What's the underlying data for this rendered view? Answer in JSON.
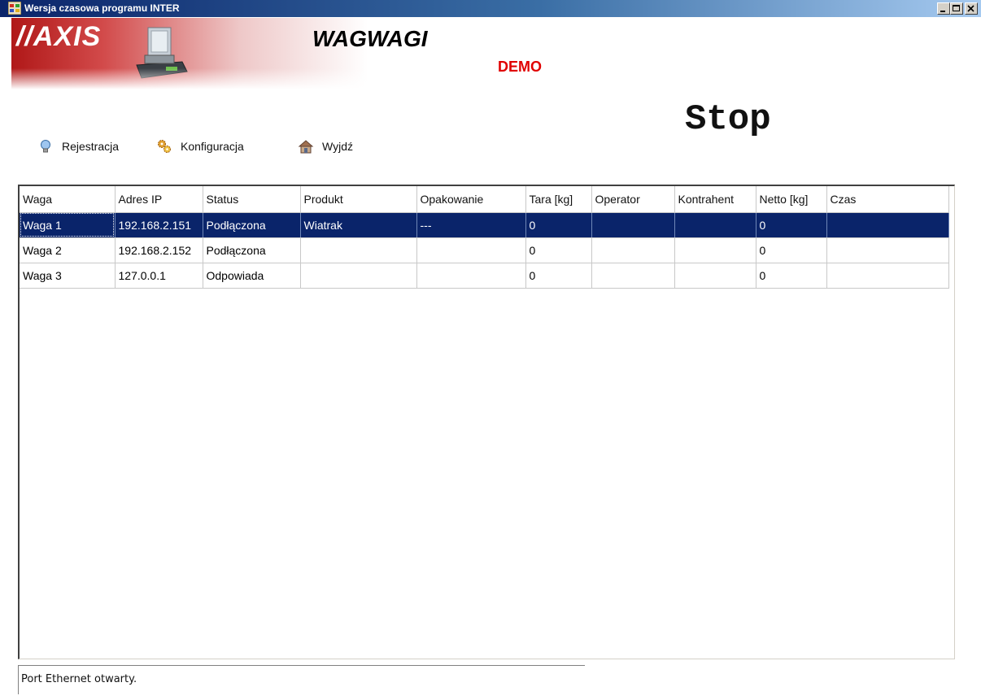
{
  "window": {
    "title": "Wersja czasowa programu INTER",
    "controls": [
      "minimize",
      "maximize",
      "close"
    ]
  },
  "banner": {
    "brand_logo": "//AXIS",
    "product_logo": "WAGWAGI",
    "demo_label": "DEMO"
  },
  "state_label": "Stop",
  "toolbar": {
    "items": [
      {
        "label": "Rejestracja",
        "icon": "lightbulb-icon"
      },
      {
        "label": "Konfiguracja",
        "icon": "gears-icon"
      },
      {
        "label": "Wyjdź",
        "icon": "house-icon"
      }
    ]
  },
  "table": {
    "columns": [
      "Waga",
      "Adres IP",
      "Status",
      "Produkt",
      "Opakowanie",
      "Tara [kg]",
      "Operator",
      "Kontrahent",
      "Netto [kg]",
      "Czas"
    ],
    "rows": [
      [
        "Waga 1",
        "192.168.2.151",
        "Podłączona",
        "Wiatrak",
        "---",
        "0",
        "",
        "",
        "0",
        ""
      ],
      [
        "Waga 2",
        "192.168.2.152",
        "Podłączona",
        "",
        "",
        "0",
        "",
        "",
        "0",
        ""
      ],
      [
        "Waga 3",
        "127.0.0.1",
        "Odpowiada",
        "",
        "",
        "0",
        "",
        "",
        "0",
        ""
      ]
    ],
    "selected_row": 0
  },
  "status_bar": {
    "text": "Port Ethernet otwarty."
  },
  "colors": {
    "title_bar": "#0a246a",
    "selection": "#0a246a",
    "demo": "#e00000",
    "banner_red": "#b01818"
  }
}
